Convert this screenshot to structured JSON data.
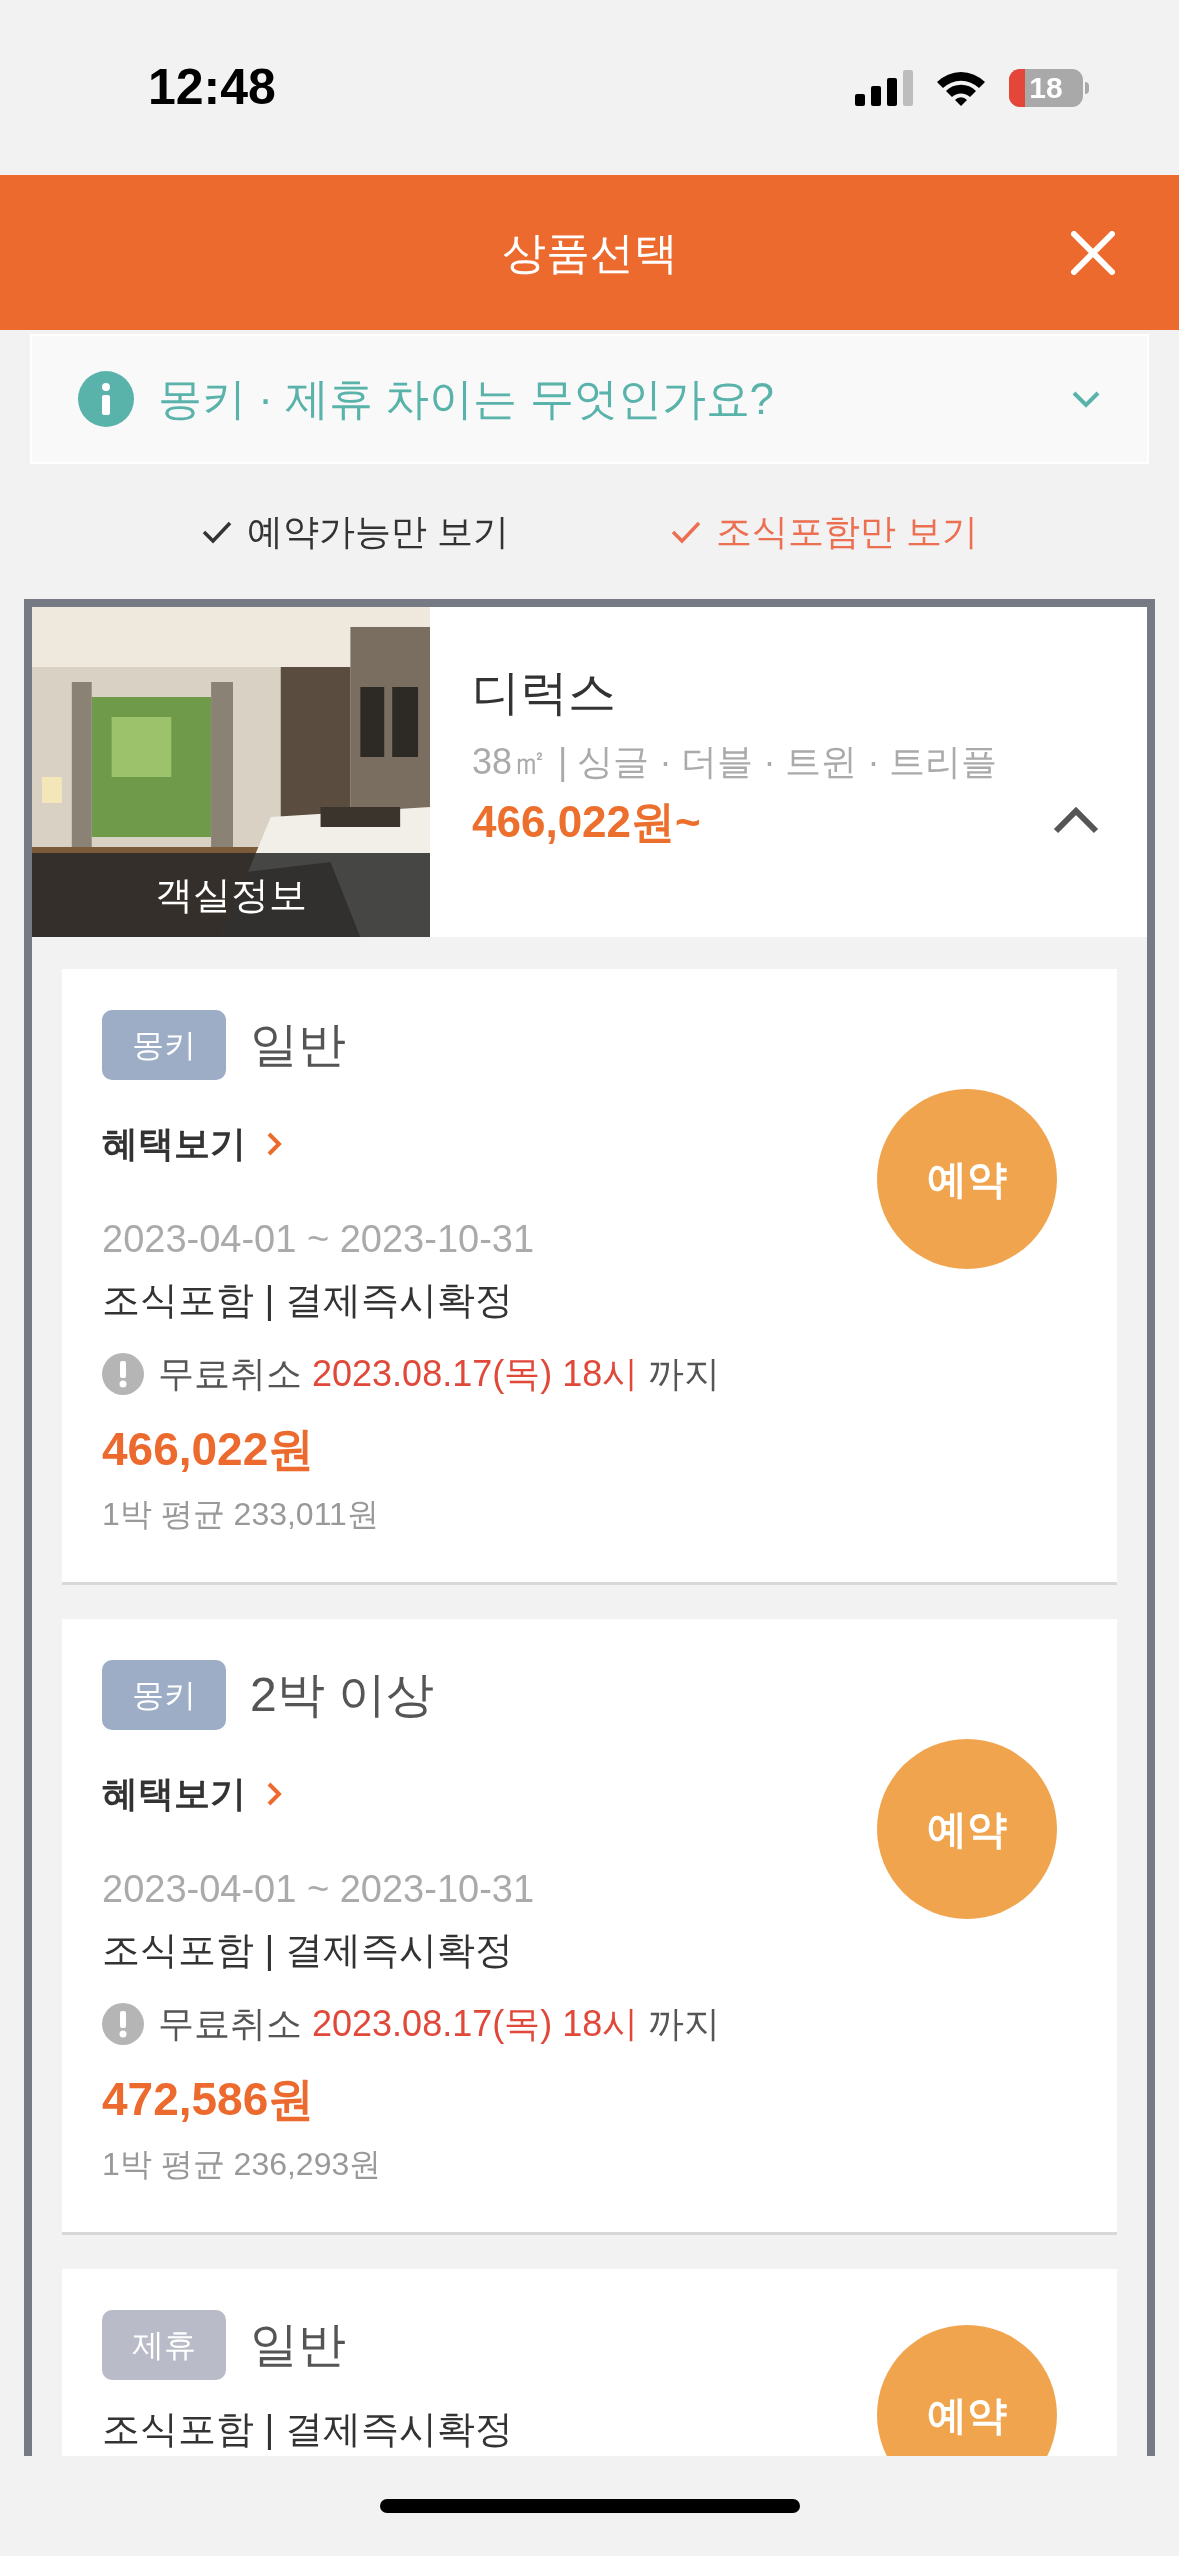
{
  "status_bar": {
    "time": "12:48",
    "battery": "18"
  },
  "header": {
    "title": "상품선택"
  },
  "info": {
    "text": "몽키 · 제휴 차이는 무엇인가요?",
    "expanded": false
  },
  "filters": [
    {
      "label": "예약가능만 보기",
      "on": false
    },
    {
      "label": "조식포함만 보기",
      "on": true
    }
  ],
  "room": {
    "name": "디럭스",
    "details": "38㎡ | 싱글 · 더블 · 트윈 · 트리플",
    "price": "466,022원~",
    "photo_label": "객실정보",
    "expanded": true
  },
  "plans": [
    {
      "tag": "몽키",
      "color": "#9eadc6",
      "name": "일반",
      "benefits": "혜택보기",
      "period": "2023-04-01 ~ 2023-10-31",
      "conditions": "조식포함 | 결제즉시확정",
      "cancel": {
        "prefix": "무료취소",
        "deadline": "2023.08.17(목) 18시",
        "suffix": "까지"
      },
      "price": "466,022원",
      "average": "1박 평균 233,011원",
      "button": "예약"
    },
    {
      "tag": "몽키",
      "color": "#9eadc6",
      "name": "2박 이상",
      "benefits": "혜택보기",
      "period": "2023-04-01 ~ 2023-10-31",
      "conditions": "조식포함 | 결제즉시확정",
      "cancel": {
        "prefix": "무료취소",
        "deadline": "2023.08.17(목) 18시",
        "suffix": "까지"
      },
      "price": "472,586원",
      "average": "1박 평균 236,293원",
      "button": "예약"
    },
    {
      "tag": "제휴",
      "color": "#b9bcc8",
      "name": "일반",
      "conditions": "조식포함 | 결제즉시확정",
      "button": "예약"
    }
  ]
}
